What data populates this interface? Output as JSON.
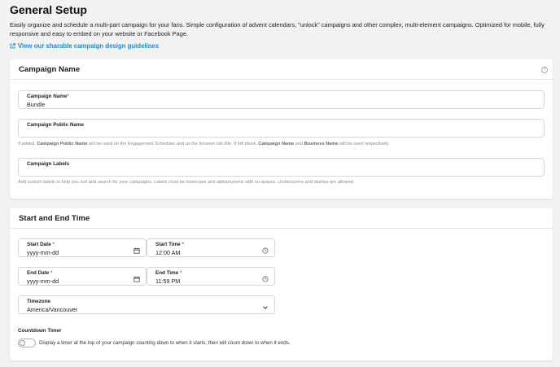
{
  "page": {
    "title": "General Setup",
    "intro": "Easily organize and schedule a multi-part campaign for your fans. Simple configuration of advent calendars, \"unlock\" campaigns and other complex, multi-element campaigns. Optimized for mobile, fully responsive and easy to embed on your website or Facebook Page.",
    "guide_link": "View our sharable campaign design guidelines"
  },
  "campaign_name_section": {
    "title": "Campaign Name",
    "help_icon": "?",
    "name_field": {
      "label": "Campaign Name",
      "required_mark": "*",
      "value": "Bundle"
    },
    "public_name_field": {
      "label": "Campaign Public Name",
      "value": "",
      "helper": {
        "part1": "If added, ",
        "term1": "Campaign Public Name",
        "part2": " will be used on the Engagement Scheduler and as the browser tab title. If left blank, ",
        "term2": "Campaign Name",
        "part3": " and ",
        "term3": "Business Name",
        "part4": " will be used respectively."
      }
    },
    "labels_field": {
      "label": "Campaign Labels",
      "value": "",
      "helper": "Add custom labels to help you sort and search for your campaigns. Labels must be lowercase and alphanumeric with no spaces. Underscores and dashes are allowed."
    }
  },
  "time_section": {
    "title": "Start and End Time",
    "start_date": {
      "label": "Start Date",
      "required_mark": "*",
      "value": "yyyy-mm-dd",
      "icon": "calendar-icon"
    },
    "start_time": {
      "label": "Start Time",
      "required_mark": "*",
      "value": "12:00 AM",
      "icon": "clock-icon"
    },
    "end_date": {
      "label": "End Date",
      "required_mark": "*",
      "value": "yyyy-mm-dd",
      "icon": "calendar-icon"
    },
    "end_time": {
      "label": "End Time",
      "required_mark": "*",
      "value": "11:59 PM",
      "icon": "clock-icon"
    },
    "timezone": {
      "label": "Timezone",
      "value": "America/Vancouver",
      "icon": "chevron-down-icon"
    },
    "countdown": {
      "label": "Countdown Timer",
      "enabled": false,
      "description": "Display a timer at the top of your campaign counting down to when it starts; then will count down to when it ends."
    }
  },
  "colors": {
    "accent": "#1c8fc9",
    "required": "#d9534f",
    "background": "#f2f2f2",
    "card": "#ffffff"
  }
}
